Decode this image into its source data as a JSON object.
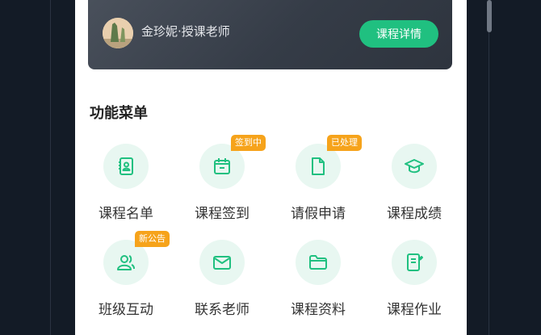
{
  "course_card": {
    "teacher": "金珍妮·授课老师",
    "detail_button": "课程详情"
  },
  "menu": {
    "title": "功能菜单",
    "items": [
      {
        "label": "课程名单",
        "icon": "roster-icon",
        "badge": ""
      },
      {
        "label": "课程签到",
        "icon": "calendar-icon",
        "badge": "签到中"
      },
      {
        "label": "请假申请",
        "icon": "document-icon",
        "badge": "已处理"
      },
      {
        "label": "课程成绩",
        "icon": "graduation-cap-icon",
        "badge": ""
      },
      {
        "label": "班级互动",
        "icon": "users-icon",
        "badge": "新公告"
      },
      {
        "label": "联系老师",
        "icon": "mail-icon",
        "badge": ""
      },
      {
        "label": "课程资料",
        "icon": "folder-icon",
        "badge": ""
      },
      {
        "label": "课程作业",
        "icon": "homework-icon",
        "badge": ""
      }
    ]
  },
  "colors": {
    "accent": "#20c080",
    "badge": "#f6a31b",
    "icon_bg": "#e8f7f1",
    "card_dark": "#3a414c",
    "backdrop": "#131b26"
  }
}
